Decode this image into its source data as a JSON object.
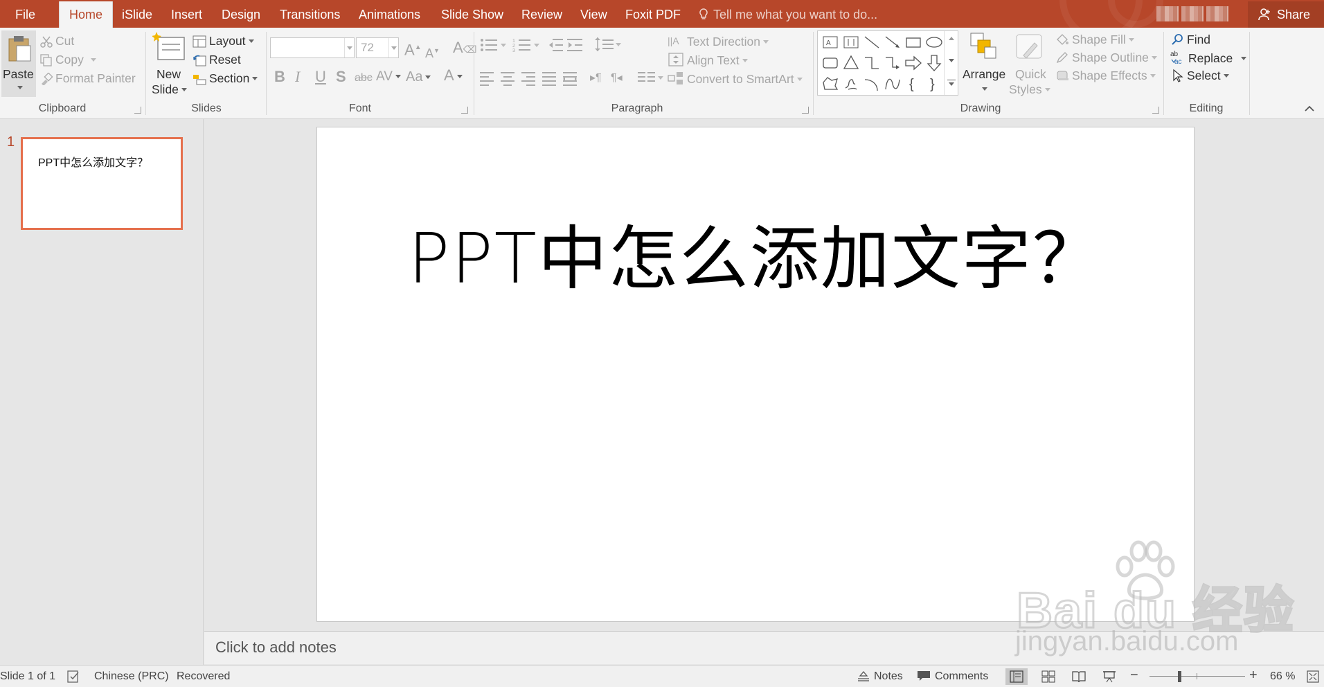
{
  "tabs": [
    {
      "id": "file",
      "label": "File"
    },
    {
      "id": "home",
      "label": "Home",
      "active": true
    },
    {
      "id": "islide",
      "label": "iSlide"
    },
    {
      "id": "insert",
      "label": "Insert"
    },
    {
      "id": "design",
      "label": "Design"
    },
    {
      "id": "transitions",
      "label": "Transitions"
    },
    {
      "id": "animations",
      "label": "Animations"
    },
    {
      "id": "slideshow",
      "label": "Slide Show"
    },
    {
      "id": "review",
      "label": "Review"
    },
    {
      "id": "view",
      "label": "View"
    },
    {
      "id": "foxit",
      "label": "Foxit PDF"
    }
  ],
  "tell_me": "Tell me what you want to do...",
  "share_label": "Share",
  "ribbon": {
    "clipboard": {
      "label": "Clipboard",
      "paste": "Paste",
      "cut": "Cut",
      "copy": "Copy",
      "format_painter": "Format Painter"
    },
    "slides": {
      "label": "Slides",
      "new_slide_line1": "New",
      "new_slide_line2": "Slide",
      "layout": "Layout",
      "reset": "Reset",
      "section": "Section"
    },
    "font": {
      "label": "Font",
      "font_name": "",
      "font_size": "72"
    },
    "paragraph": {
      "label": "Paragraph",
      "text_direction": "Text Direction",
      "align_text": "Align Text",
      "convert_smartart": "Convert to SmartArt"
    },
    "drawing": {
      "label": "Drawing",
      "arrange": "Arrange",
      "quick_styles_line1": "Quick",
      "quick_styles_line2": "Styles",
      "shape_fill": "Shape Fill",
      "shape_outline": "Shape Outline",
      "shape_effects": "Shape Effects"
    },
    "editing": {
      "label": "Editing",
      "find": "Find",
      "replace": "Replace",
      "select": "Select"
    }
  },
  "thumbnail": {
    "number": "1",
    "title": "PPT中怎么添加文字？"
  },
  "slide": {
    "title": "PPT中怎么添加文字？"
  },
  "notes_placeholder": "Click to add notes",
  "status": {
    "slide_count": "Slide 1 of 1",
    "language": "Chinese (PRC)",
    "recovered": "Recovered",
    "notes": "Notes",
    "comments": "Comments",
    "zoom_percent": 66,
    "zoom": "66 %"
  },
  "watermark": {
    "logo": "Bai du 经验",
    "url": "jingyan.baidu.com"
  },
  "colors": {
    "accent": "#b7472a",
    "thumb_border": "#e5704d"
  }
}
